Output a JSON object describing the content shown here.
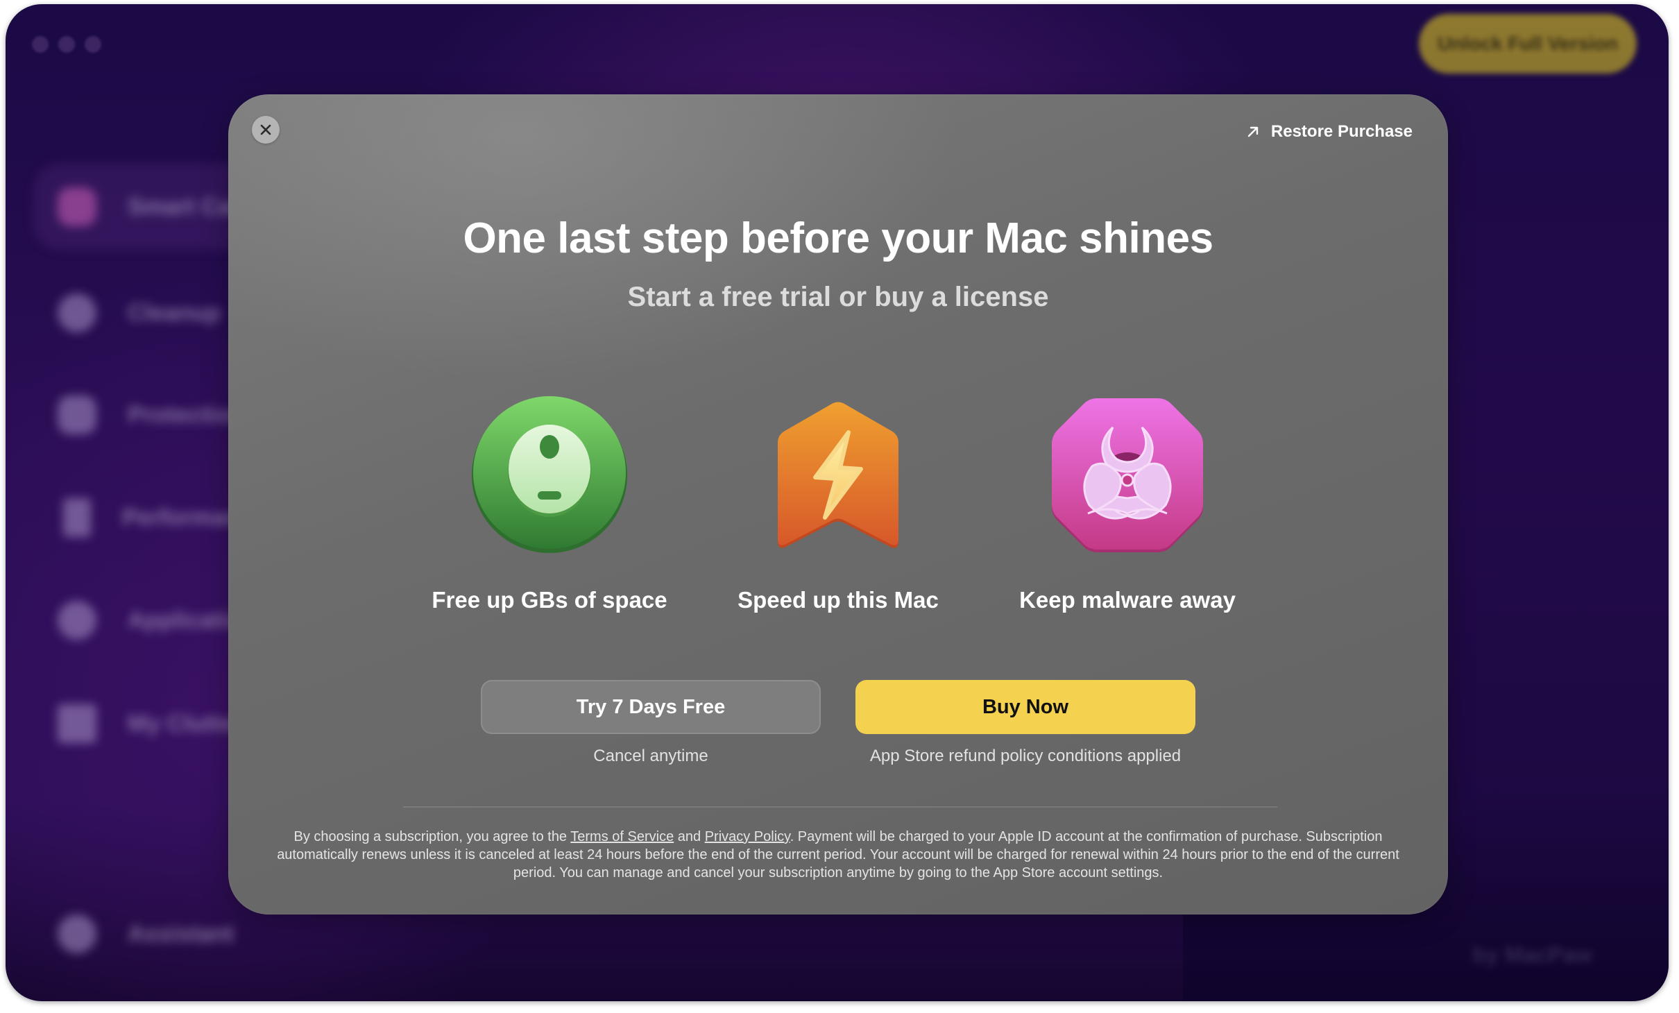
{
  "window": {
    "unlock_button": "Unlock Full Version",
    "brand": "by MacPaw"
  },
  "sidebar": {
    "items": [
      {
        "label": "Smart Care",
        "icon": "smart-care-icon",
        "selected": true
      },
      {
        "label": "Cleanup",
        "icon": "cleanup-icon"
      },
      {
        "label": "Protection",
        "icon": "protection-icon"
      },
      {
        "label": "Performance",
        "icon": "performance-icon"
      },
      {
        "label": "Applications",
        "icon": "applications-icon"
      },
      {
        "label": "My Clutter",
        "icon": "my-clutter-icon"
      },
      {
        "label": "Assistant",
        "icon": "assistant-icon"
      }
    ]
  },
  "modal": {
    "close_icon": "close-icon",
    "restore_label": "Restore Purchase",
    "restore_icon": "arrow-up-right-icon",
    "title": "One last step before your Mac shines",
    "subtitle": "Start a free trial or buy a license",
    "features": [
      {
        "label": "Free up GBs of space",
        "icon": "cleanup-disk-icon",
        "color": "#4caa45"
      },
      {
        "label": "Speed up this Mac",
        "icon": "lightning-icon",
        "color": "#e8782a"
      },
      {
        "label": "Keep malware away",
        "icon": "biohazard-icon",
        "color": "#d84ab0"
      }
    ],
    "try_button": "Try 7 Days Free",
    "try_subtext": "Cancel anytime",
    "buy_button": "Buy Now",
    "buy_subtext": "App Store refund policy conditions applied",
    "buy_color": "#f4d250",
    "legal": {
      "prefix": "By choosing a subscription, you agree to the ",
      "terms_link": "Terms of Service",
      "and": " and ",
      "privacy_link": "Privacy Policy",
      "suffix": ". Payment will be charged to your Apple ID account at the confirmation of purchase. Subscription automatically renews unless it is canceled at least 24 hours before the end of the current period. Your account will be charged for renewal within 24 hours prior to the end of the current period. You can manage and cancel your subscription anytime by going to the App Store account settings."
    }
  }
}
